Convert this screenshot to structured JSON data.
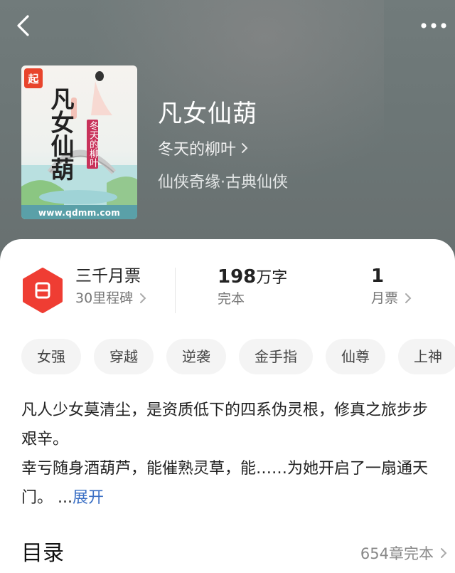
{
  "nav": {
    "back_icon": "chevron-left-icon",
    "more_icon": "more-dots-icon"
  },
  "cover": {
    "badge": "起",
    "title": "凡女仙葫",
    "author": "冬天的柳叶",
    "url": "www.qdmm.com"
  },
  "book": {
    "title": "凡女仙葫",
    "author": "冬天的柳叶",
    "genre": "仙侠奇缘·古典仙侠"
  },
  "stats": {
    "ticket_title": "三千月票",
    "ticket_sub": "30里程碑",
    "words_num": "198",
    "words_unit": "万字",
    "status": "完本",
    "votes_num": "1",
    "votes_label": "月票"
  },
  "tags": [
    "女强",
    "穿越",
    "逆袭",
    "金手指",
    "仙尊",
    "上神"
  ],
  "intro": {
    "line1": "凡人少女莫清尘，是资质低下的四系伪灵根，修真之旅步步艰辛。",
    "line2": "幸亏随身酒葫芦，能催熟灵草，能……为她开启了一扇通天门。",
    "more_prefix": "...",
    "expand": "展开"
  },
  "toc": {
    "title": "目录",
    "meta": "654章完本"
  },
  "colors": {
    "hero_bg": "#6c7676",
    "accent_red": "#e8442c",
    "link_blue": "#3a6fc4"
  }
}
